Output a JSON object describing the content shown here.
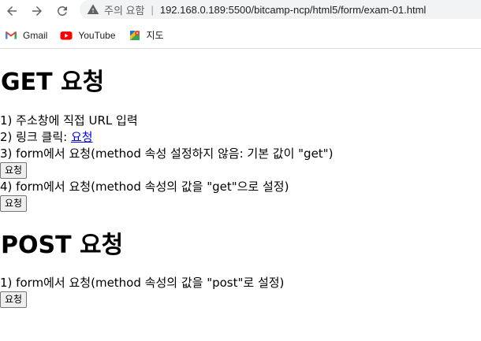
{
  "browser": {
    "security_label": "주의 요함",
    "url": "192.168.0.189:5500/bitcamp-ncp/html5/form/exam-01.html",
    "bookmarks": [
      {
        "label": "Gmail",
        "icon": "gmail-icon"
      },
      {
        "label": "YouTube",
        "icon": "youtube-icon"
      },
      {
        "label": "지도",
        "icon": "maps-icon"
      }
    ]
  },
  "page": {
    "get_heading": "GET 요청",
    "get_items": {
      "item1": "1) 주소창에 직접 URL 입력",
      "item2_prefix": "2) 링크 클릭: ",
      "item2_link": "요청",
      "item3": "3) form에서 요청(method 속성 설정하지 않음: 기본 값이 \"get\")",
      "item4": "4) form에서 요청(method 속성의 값을 \"get\"으로 설정)"
    },
    "post_heading": "POST 요청",
    "post_items": {
      "item1": "1) form에서 요청(method 속성의 값을 \"post\"로 설정)"
    },
    "submit_label": "요청"
  }
}
